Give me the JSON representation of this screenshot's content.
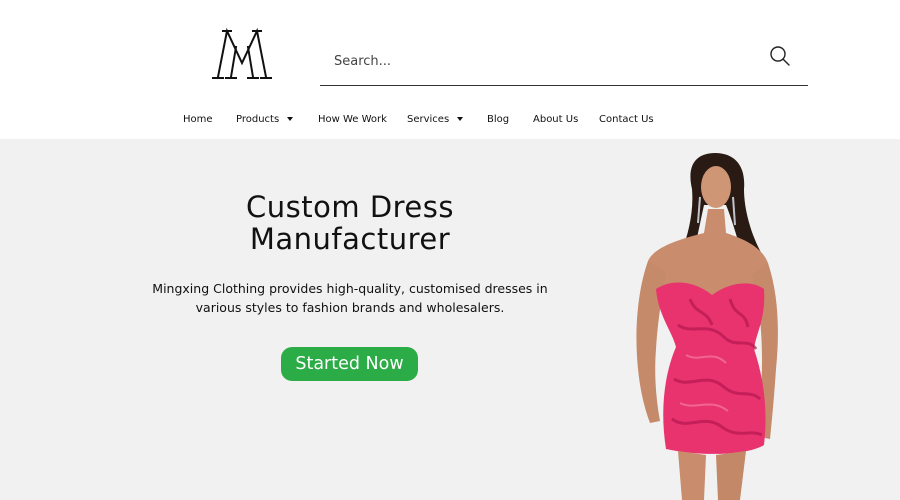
{
  "brand": {
    "logo_text": "M",
    "logo_icon": "monogram-logo-icon"
  },
  "search": {
    "placeholder": "Search...",
    "value": "",
    "icon": "search-icon"
  },
  "nav": {
    "items": [
      {
        "label": "Home",
        "has_dropdown": false
      },
      {
        "label": "Products",
        "has_dropdown": true
      },
      {
        "label": "How We Work",
        "has_dropdown": false
      },
      {
        "label": "Services",
        "has_dropdown": true
      },
      {
        "label": "Blog",
        "has_dropdown": false
      },
      {
        "label": "About Us",
        "has_dropdown": false
      },
      {
        "label": "Contact Us",
        "has_dropdown": false
      }
    ]
  },
  "hero": {
    "title": "Custom  Dress\nManufacturer",
    "description": "Mingxing Clothing provides high-quality, customised dresses in various styles to fashion brands and wholesalers.",
    "cta_label": "Started Now",
    "image": "model-in-pink-sequin-dress"
  },
  "colors": {
    "hero_bg": "#f1f1f1",
    "cta_bg": "#2bac46",
    "dress_pink": "#e8336f"
  }
}
